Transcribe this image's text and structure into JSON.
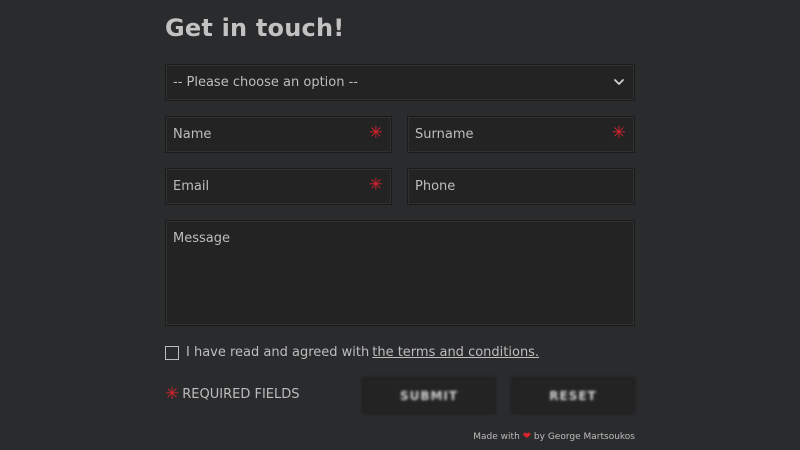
{
  "page": {
    "title": "Get in touch!"
  },
  "form": {
    "select": {
      "value": "-- Please choose an option --",
      "icon": "chevron-down-icon"
    },
    "name": {
      "placeholder": "Name",
      "required": true
    },
    "surname": {
      "placeholder": "Surname",
      "required": true
    },
    "email": {
      "placeholder": "Email",
      "required": true
    },
    "phone": {
      "placeholder": "Phone",
      "required": false
    },
    "message": {
      "placeholder": "Message",
      "required": false
    },
    "required_marker": "✳",
    "terms": {
      "prefix": "I have read and agreed with",
      "link_text": "the terms and conditions."
    },
    "required_note": "REQUIRED FIELDS",
    "submit_label": "SUBMIT",
    "reset_label": "RESET"
  },
  "footer": {
    "made_with": "Made with",
    "heart": "❤",
    "by": "by George Martsoukos"
  },
  "colors": {
    "background": "#2a2b2d",
    "field": "#232323",
    "required": "#d9232e",
    "text": "#bdbdbd"
  }
}
